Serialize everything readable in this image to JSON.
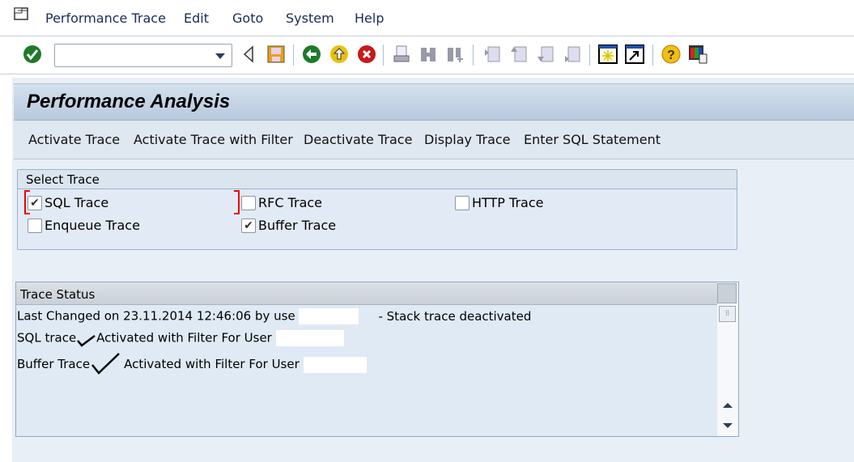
{
  "menu": {
    "items": [
      "Performance Trace",
      "Edit",
      "Goto",
      "System",
      "Help"
    ]
  },
  "toolbar": {
    "command_value": ""
  },
  "page": {
    "title": "Performance Analysis"
  },
  "app_toolbar": {
    "buttons": [
      "Activate Trace",
      "Activate Trace with Filter",
      "Deactivate Trace",
      "Display Trace",
      "Enter SQL Statement"
    ]
  },
  "select_trace": {
    "title": "Select Trace",
    "options": [
      {
        "label": "SQL Trace",
        "checked": true
      },
      {
        "label": "RFC Trace",
        "checked": false
      },
      {
        "label": "HTTP Trace",
        "checked": false
      },
      {
        "label": "Enqueue Trace",
        "checked": false
      },
      {
        "label": "Buffer Trace",
        "checked": true
      }
    ]
  },
  "trace_status": {
    "title": "Trace Status",
    "line1": "Last Changed on 23.11.2014 12:46:06 by use",
    "line1_suffix": "- Stack trace deactivated",
    "line2_prefix": "SQL trace",
    "line2": "Activated with Filter For User",
    "line3_prefix": "Buffer Trace",
    "line3": "Activated with Filter For User"
  },
  "colors": {
    "accent": "#e00000",
    "bg": "#e9eff7"
  }
}
